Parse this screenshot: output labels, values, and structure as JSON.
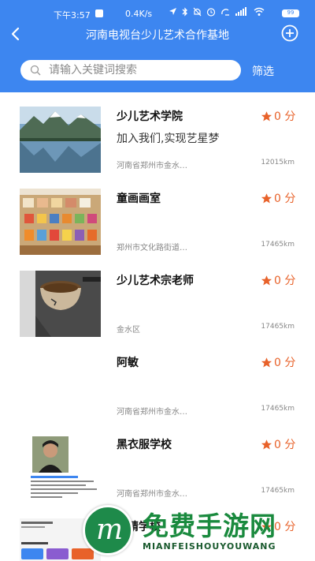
{
  "status_bar": {
    "time": "下午3:57",
    "speed": "0.4K/s",
    "battery": "99"
  },
  "header": {
    "title": "河南电视台少儿艺术合作基地",
    "back_icon": "chevron-left-icon",
    "add_icon": "plus-circle-icon"
  },
  "search": {
    "placeholder": "请输入关键词搜索",
    "value": "",
    "filter_label": "筛选"
  },
  "colors": {
    "header_bg": "#3d86f0",
    "rating": "#e8622a",
    "watermark_green": "#1a8a3e"
  },
  "items": [
    {
      "title": "少儿艺术学院",
      "subtitle": "加入我们,实现艺星梦",
      "address": "河南省郑州市金水…",
      "distance": "12015km",
      "rating": "0 分",
      "thumb": "lake-mountain-photo"
    },
    {
      "title": "童画画室",
      "subtitle": "",
      "address": "郑州市文化路街道…",
      "distance": "17465km",
      "rating": "0 分",
      "thumb": "art-studio-photo"
    },
    {
      "title": "少儿艺术宗老师",
      "subtitle": "",
      "address": "金水区",
      "distance": "17465km",
      "rating": "0 分",
      "thumb": "tea-cup-photo"
    },
    {
      "title": "阿敏",
      "subtitle": "",
      "address": "河南省郑州市金水…",
      "distance": "17465km",
      "rating": "0 分",
      "thumb": ""
    },
    {
      "title": "黑衣服学校",
      "subtitle": "",
      "address": "河南省郑州市金水…",
      "distance": "17465km",
      "rating": "0 分",
      "thumb": "person-screenshot-photo"
    },
    {
      "title": "亚精学校",
      "subtitle": "",
      "address": "",
      "distance": "",
      "rating": "0 分",
      "thumb": "data-screenshot-photo"
    }
  ],
  "watermark": {
    "main": "免费手游网",
    "sub": "MIANFEISHOUYOUWANG",
    "logo_letter": "m"
  }
}
